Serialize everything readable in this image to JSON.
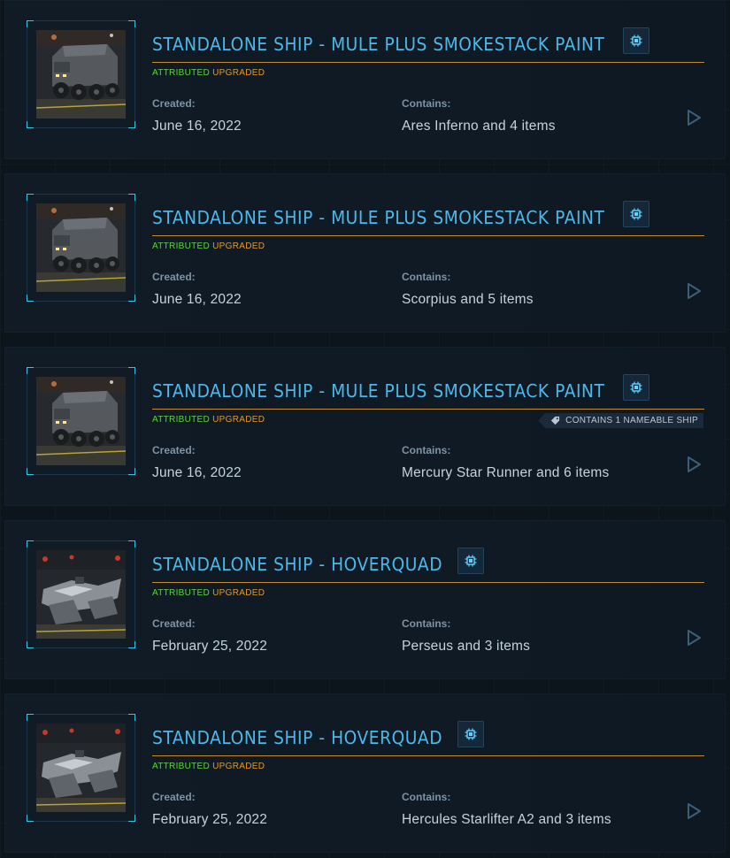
{
  "labels": {
    "created": "Created:",
    "contains": "Contains:"
  },
  "status": {
    "attributed": "ATTRIBUTED",
    "upgraded": "UPGRADED"
  },
  "colors": {
    "title": "#4fb7e8",
    "accent_rule": "#c58a2c",
    "attributed": "#5bd63a",
    "upgraded": "#e09a2a",
    "corner": "#39c3e6"
  },
  "items": [
    {
      "title": "STANDALONE SHIP - MULE PLUS SMOKESTACK PAINT",
      "created": "June 16, 2022",
      "contains": "Ares Inferno and 4 items",
      "thumbnail": "mule-ship-image",
      "nameable": ""
    },
    {
      "title": "STANDALONE SHIP - MULE PLUS SMOKESTACK PAINT",
      "created": "June 16, 2022",
      "contains": "Scorpius and 5 items",
      "thumbnail": "mule-ship-image",
      "nameable": ""
    },
    {
      "title": "STANDALONE SHIP - MULE PLUS SMOKESTACK PAINT",
      "created": "June 16, 2022",
      "contains": "Mercury Star Runner and 6 items",
      "thumbnail": "mule-ship-image",
      "nameable": "CONTAINS 1 NAMEABLE SHIP"
    },
    {
      "title": "STANDALONE SHIP - HOVERQUAD",
      "created": "February 25, 2022",
      "contains": "Perseus and 3 items",
      "thumbnail": "hoverquad-ship-image",
      "nameable": ""
    },
    {
      "title": "STANDALONE SHIP - HOVERQUAD",
      "created": "February 25, 2022",
      "contains": "Hercules Starlifter A2 and 3 items",
      "thumbnail": "hoverquad-ship-image",
      "nameable": ""
    }
  ]
}
